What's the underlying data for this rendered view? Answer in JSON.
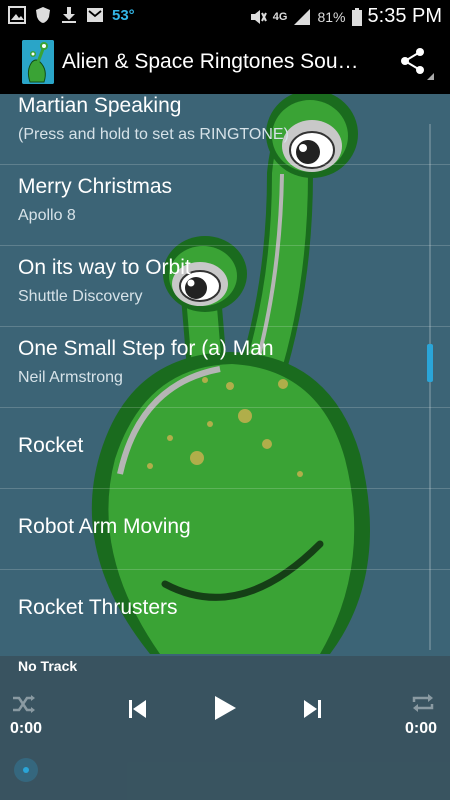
{
  "status_bar": {
    "temperature": "53°",
    "network": "4G LTE",
    "battery": "81%",
    "time": "5:35 PM",
    "accent": "#33b5e5"
  },
  "app_bar": {
    "title": "Alien & Space Ringtones Sou…",
    "share_icon": "share-icon"
  },
  "list": {
    "items": [
      {
        "title": "Martian Speaking",
        "subtitle": "(Press and hold to set as RINGTONE)"
      },
      {
        "title": "Merry Christmas",
        "subtitle": "Apollo 8"
      },
      {
        "title": "On its way to Orbit",
        "subtitle": "Shuttle Discovery"
      },
      {
        "title": "One Small Step for (a) Man",
        "subtitle": "Neil Armstrong"
      },
      {
        "title": "Rocket",
        "subtitle": ""
      },
      {
        "title": "Robot Arm Moving",
        "subtitle": ""
      },
      {
        "title": "Rocket Thrusters",
        "subtitle": ""
      }
    ]
  },
  "player": {
    "track": "No Track",
    "elapsed": "0:00",
    "duration": "0:00",
    "progress": 0
  },
  "colors": {
    "background": "#3c6476",
    "alien_green": "#3aa335",
    "alien_dark": "#1a6b1e",
    "scroll_accent": "#2aa5d8"
  }
}
